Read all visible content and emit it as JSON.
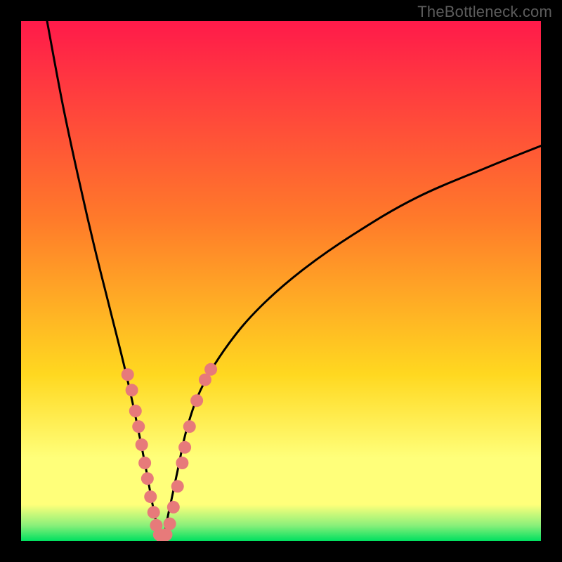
{
  "watermark": "TheBottleneck.com",
  "colors": {
    "gradient_top": "#ff1a4a",
    "gradient_mid1": "#ff7a2a",
    "gradient_mid2": "#ffd820",
    "gradient_band": "#ffff7a",
    "gradient_bottom": "#00e060",
    "curve": "#000000",
    "points": "#e77a7a",
    "frame": "#000000"
  },
  "chart_data": {
    "type": "line",
    "title": "",
    "xlabel": "",
    "ylabel": "",
    "xlim": [
      0,
      100
    ],
    "ylim": [
      0,
      100
    ],
    "notch_x": 27,
    "series": [
      {
        "name": "bottleneck-curve",
        "x": [
          5,
          8,
          11,
          14,
          17,
          20,
          22,
          24,
          25.5,
          27,
          28.5,
          30,
          32,
          35,
          40,
          46,
          54,
          64,
          76,
          90,
          100
        ],
        "y": [
          100,
          84,
          70,
          57,
          45,
          33,
          24,
          14,
          6,
          0,
          6,
          13,
          22,
          30,
          38,
          45,
          52,
          59,
          66,
          72,
          76
        ]
      }
    ],
    "points": [
      {
        "x": 20.5,
        "y": 32
      },
      {
        "x": 21.3,
        "y": 29
      },
      {
        "x": 22.0,
        "y": 25
      },
      {
        "x": 22.6,
        "y": 22
      },
      {
        "x": 23.2,
        "y": 18.5
      },
      {
        "x": 23.8,
        "y": 15
      },
      {
        "x": 24.3,
        "y": 12
      },
      {
        "x": 24.9,
        "y": 8.5
      },
      {
        "x": 25.5,
        "y": 5.5
      },
      {
        "x": 26.0,
        "y": 3
      },
      {
        "x": 26.6,
        "y": 1.2
      },
      {
        "x": 27.2,
        "y": 0.5
      },
      {
        "x": 27.9,
        "y": 1.2
      },
      {
        "x": 28.6,
        "y": 3.3
      },
      {
        "x": 29.3,
        "y": 6.5
      },
      {
        "x": 30.1,
        "y": 10.5
      },
      {
        "x": 31.0,
        "y": 15
      },
      {
        "x": 31.5,
        "y": 18
      },
      {
        "x": 32.4,
        "y": 22
      },
      {
        "x": 33.8,
        "y": 27
      },
      {
        "x": 35.4,
        "y": 31
      },
      {
        "x": 36.5,
        "y": 33
      }
    ]
  }
}
